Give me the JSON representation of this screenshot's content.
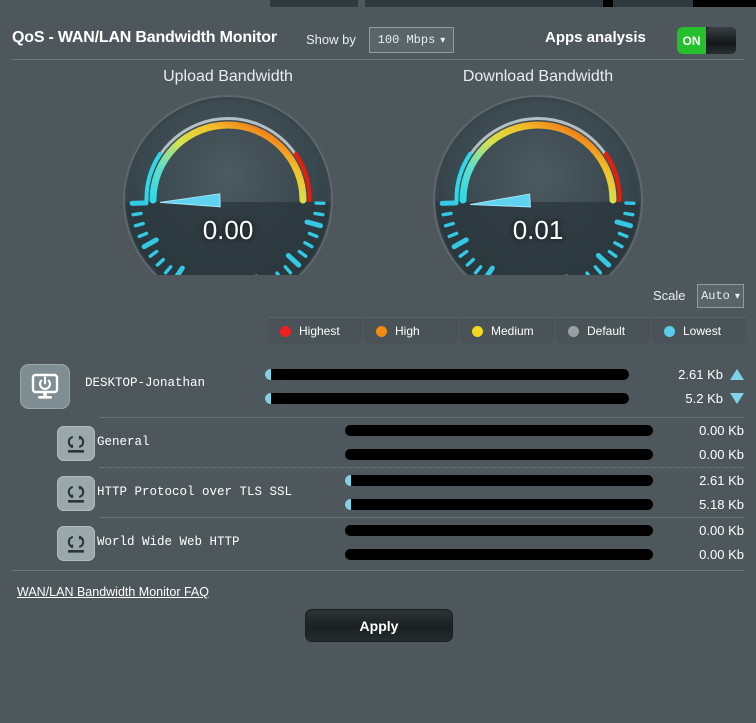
{
  "header": {
    "title": "QoS - WAN/LAN Bandwidth Monitor",
    "show_by_label": "Show by",
    "show_by_value": "100 Mbps",
    "apps_analysis_label": "Apps analysis",
    "toggle_state": "ON"
  },
  "gauges": [
    {
      "name": "upload",
      "title": "Upload Bandwidth",
      "value": "0.00",
      "needle_fraction": 0.0
    },
    {
      "name": "download",
      "title": "Download Bandwidth",
      "value": "0.01",
      "needle_fraction": 0.01
    }
  ],
  "scale": {
    "label": "Scale",
    "value": "Auto"
  },
  "legend": [
    {
      "label": "Highest",
      "color": "#f02020"
    },
    {
      "label": "High",
      "color": "#f08a12"
    },
    {
      "label": "Medium",
      "color": "#f2d821"
    },
    {
      "label": "Default",
      "color": "#9aa0a2"
    },
    {
      "label": "Lowest",
      "color": "#59cdea"
    }
  ],
  "device": {
    "name": "DESKTOP-Jonathan",
    "icon": "monitor-power-icon",
    "upload": {
      "value": "2.61 Kb",
      "fill_percent": 1.6
    },
    "download": {
      "value": "5.2 Kb",
      "fill_percent": 1.6
    }
  },
  "apps": [
    {
      "name": "General",
      "icon": "app-traffic-icon",
      "upload": {
        "value": "0.00 Kb",
        "fill_percent": 0
      },
      "download": {
        "value": "0.00 Kb",
        "fill_percent": 0
      }
    },
    {
      "name": "HTTP Protocol over TLS SSL",
      "icon": "app-traffic-icon",
      "upload": {
        "value": "2.61 Kb",
        "fill_percent": 1.8
      },
      "download": {
        "value": "5.18 Kb",
        "fill_percent": 1.8
      }
    },
    {
      "name": "World Wide Web HTTP",
      "icon": "app-traffic-icon",
      "upload": {
        "value": "0.00 Kb",
        "fill_percent": 0
      },
      "download": {
        "value": "0.00 Kb",
        "fill_percent": 0
      }
    }
  ],
  "footer": {
    "faq_link": "WAN/LAN Bandwidth Monitor FAQ",
    "apply_label": "Apply"
  },
  "colors": {
    "background": "#4e585c",
    "accent_cyan": "#7fd2e8",
    "toggle_on": "#25c02c",
    "bar_track": "#000000"
  }
}
